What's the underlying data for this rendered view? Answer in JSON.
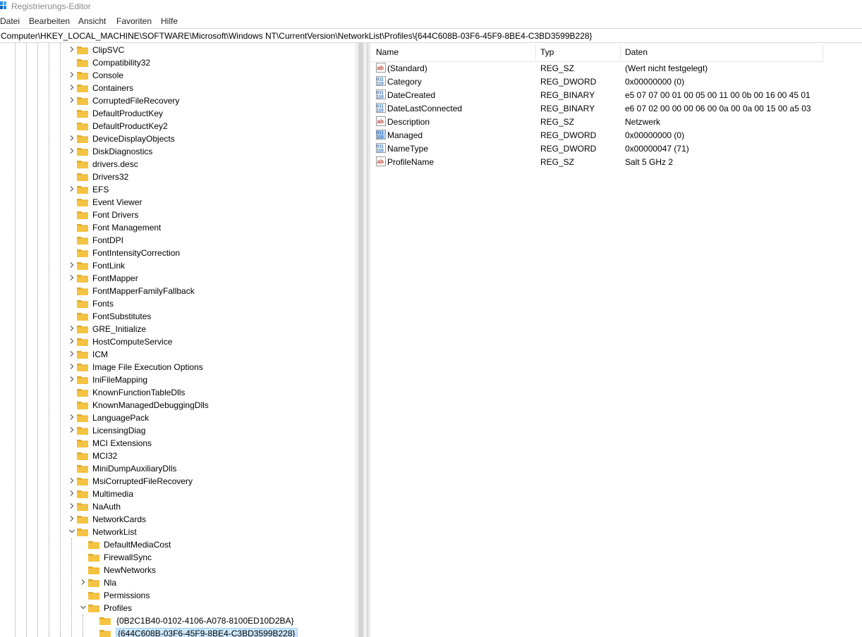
{
  "window": {
    "title": "Registrierungs-Editor"
  },
  "menu": [
    {
      "label": "Datei"
    },
    {
      "label": "Bearbeiten"
    },
    {
      "label": "Ansicht"
    },
    {
      "label": "Favoriten"
    },
    {
      "label": "Hilfe"
    }
  ],
  "address": "Computer\\HKEY_LOCAL_MACHINE\\SOFTWARE\\Microsoft\\Windows NT\\CurrentVersion\\NetworkList\\Profiles\\{644C608B-03F6-45F9-8BE4-C3BD3599B228}",
  "tree": [
    {
      "label": "ClipSVC",
      "depth": 0,
      "chevron": "collapsed"
    },
    {
      "label": "Compatibility32",
      "depth": 0,
      "chevron": "none"
    },
    {
      "label": "Console",
      "depth": 0,
      "chevron": "collapsed"
    },
    {
      "label": "Containers",
      "depth": 0,
      "chevron": "collapsed"
    },
    {
      "label": "CorruptedFileRecovery",
      "depth": 0,
      "chevron": "collapsed"
    },
    {
      "label": "DefaultProductKey",
      "depth": 0,
      "chevron": "none"
    },
    {
      "label": "DefaultProductKey2",
      "depth": 0,
      "chevron": "none"
    },
    {
      "label": "DeviceDisplayObjects",
      "depth": 0,
      "chevron": "collapsed"
    },
    {
      "label": "DiskDiagnostics",
      "depth": 0,
      "chevron": "collapsed"
    },
    {
      "label": "drivers.desc",
      "depth": 0,
      "chevron": "none"
    },
    {
      "label": "Drivers32",
      "depth": 0,
      "chevron": "none"
    },
    {
      "label": "EFS",
      "depth": 0,
      "chevron": "collapsed"
    },
    {
      "label": "Event Viewer",
      "depth": 0,
      "chevron": "none"
    },
    {
      "label": "Font Drivers",
      "depth": 0,
      "chevron": "none"
    },
    {
      "label": "Font Management",
      "depth": 0,
      "chevron": "none"
    },
    {
      "label": "FontDPI",
      "depth": 0,
      "chevron": "none"
    },
    {
      "label": "FontIntensityCorrection",
      "depth": 0,
      "chevron": "none"
    },
    {
      "label": "FontLink",
      "depth": 0,
      "chevron": "collapsed"
    },
    {
      "label": "FontMapper",
      "depth": 0,
      "chevron": "collapsed"
    },
    {
      "label": "FontMapperFamilyFallback",
      "depth": 0,
      "chevron": "none"
    },
    {
      "label": "Fonts",
      "depth": 0,
      "chevron": "none"
    },
    {
      "label": "FontSubstitutes",
      "depth": 0,
      "chevron": "none"
    },
    {
      "label": "GRE_Initialize",
      "depth": 0,
      "chevron": "collapsed"
    },
    {
      "label": "HostComputeService",
      "depth": 0,
      "chevron": "collapsed"
    },
    {
      "label": "ICM",
      "depth": 0,
      "chevron": "collapsed"
    },
    {
      "label": "Image File Execution Options",
      "depth": 0,
      "chevron": "collapsed"
    },
    {
      "label": "IniFileMapping",
      "depth": 0,
      "chevron": "collapsed"
    },
    {
      "label": "KnownFunctionTableDlls",
      "depth": 0,
      "chevron": "none"
    },
    {
      "label": "KnownManagedDebuggingDlls",
      "depth": 0,
      "chevron": "none"
    },
    {
      "label": "LanguagePack",
      "depth": 0,
      "chevron": "collapsed"
    },
    {
      "label": "LicensingDiag",
      "depth": 0,
      "chevron": "collapsed"
    },
    {
      "label": "MCI Extensions",
      "depth": 0,
      "chevron": "none"
    },
    {
      "label": "MCI32",
      "depth": 0,
      "chevron": "none"
    },
    {
      "label": "MiniDumpAuxiliaryDlls",
      "depth": 0,
      "chevron": "none"
    },
    {
      "label": "MsiCorruptedFileRecovery",
      "depth": 0,
      "chevron": "collapsed"
    },
    {
      "label": "Multimedia",
      "depth": 0,
      "chevron": "collapsed"
    },
    {
      "label": "NaAuth",
      "depth": 0,
      "chevron": "collapsed"
    },
    {
      "label": "NetworkCards",
      "depth": 0,
      "chevron": "collapsed"
    },
    {
      "label": "NetworkList",
      "depth": 0,
      "chevron": "expanded"
    },
    {
      "label": "DefaultMediaCost",
      "depth": 1,
      "chevron": "none"
    },
    {
      "label": "FirewallSync",
      "depth": 1,
      "chevron": "none"
    },
    {
      "label": "NewNetworks",
      "depth": 1,
      "chevron": "none"
    },
    {
      "label": "Nla",
      "depth": 1,
      "chevron": "collapsed"
    },
    {
      "label": "Permissions",
      "depth": 1,
      "chevron": "none"
    },
    {
      "label": "Profiles",
      "depth": 1,
      "chevron": "expanded"
    },
    {
      "label": "{0B2C1B40-0102-4106-A078-8100ED10D2BA}",
      "depth": 2,
      "chevron": "none"
    },
    {
      "label": "{644C608B-03F6-45F9-8BE4-C3BD3599B228}",
      "depth": 2,
      "chevron": "none",
      "selected": true
    }
  ],
  "columns": {
    "name": "Name",
    "type": "Typ",
    "data": "Daten"
  },
  "values": [
    {
      "name": "(Standard)",
      "type": "REG_SZ",
      "data": "(Wert nicht festgelegt)",
      "icon": "string"
    },
    {
      "name": "Category",
      "type": "REG_DWORD",
      "data": "0x00000000 (0)",
      "icon": "binary"
    },
    {
      "name": "DateCreated",
      "type": "REG_BINARY",
      "data": "e5 07 07 00 01 00 05 00 11 00 0b 00 16 00 45 01",
      "icon": "binary"
    },
    {
      "name": "DateLastConnected",
      "type": "REG_BINARY",
      "data": "e6 07 02 00 00 00 06 00 0a 00 0a 00 15 00 a5 03",
      "icon": "binary"
    },
    {
      "name": "Description",
      "type": "REG_SZ",
      "data": "Netzwerk",
      "icon": "string"
    },
    {
      "name": "Managed",
      "type": "REG_DWORD",
      "data": "0x00000000 (0)",
      "icon": "binary-selected"
    },
    {
      "name": "NameType",
      "type": "REG_DWORD",
      "data": "0x00000047 (71)",
      "icon": "binary"
    },
    {
      "name": "ProfileName",
      "type": "REG_SZ",
      "data": "Salt 5 GHz 2",
      "icon": "string"
    }
  ],
  "colors": {
    "folder": "#f5c342",
    "folder_dark": "#e0a92a",
    "selection": "#cce8ff",
    "icon_blue": "#1a5fb4",
    "icon_red": "#c0392b"
  }
}
